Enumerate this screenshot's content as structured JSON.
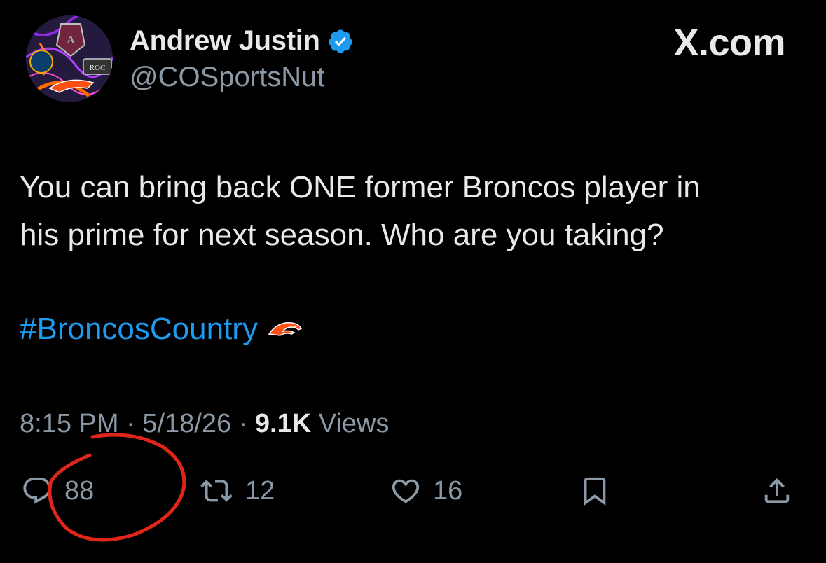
{
  "header": {
    "display_name": "Andrew Justin",
    "handle": "@COSportsNut",
    "brand": "X.com",
    "avatar_text": "ROC"
  },
  "tweet": {
    "line1": "You can bring back ONE former Broncos player in",
    "line2": "his prime for next season. Who are you taking?",
    "hashtag": "#BroncosCountry"
  },
  "meta": {
    "time": "8:15 PM",
    "date": "5/18/26",
    "views_count": "9.1K",
    "views_label": "Views",
    "separator": "·"
  },
  "actions": {
    "replies": "88",
    "reposts": "12",
    "likes": "16"
  },
  "colors": {
    "background": "#000000",
    "text": "#e7e9ea",
    "muted": "#8b98a5",
    "link": "#1d9bf0",
    "verified": "#1d9bf0",
    "annotation": "#e0261a"
  }
}
